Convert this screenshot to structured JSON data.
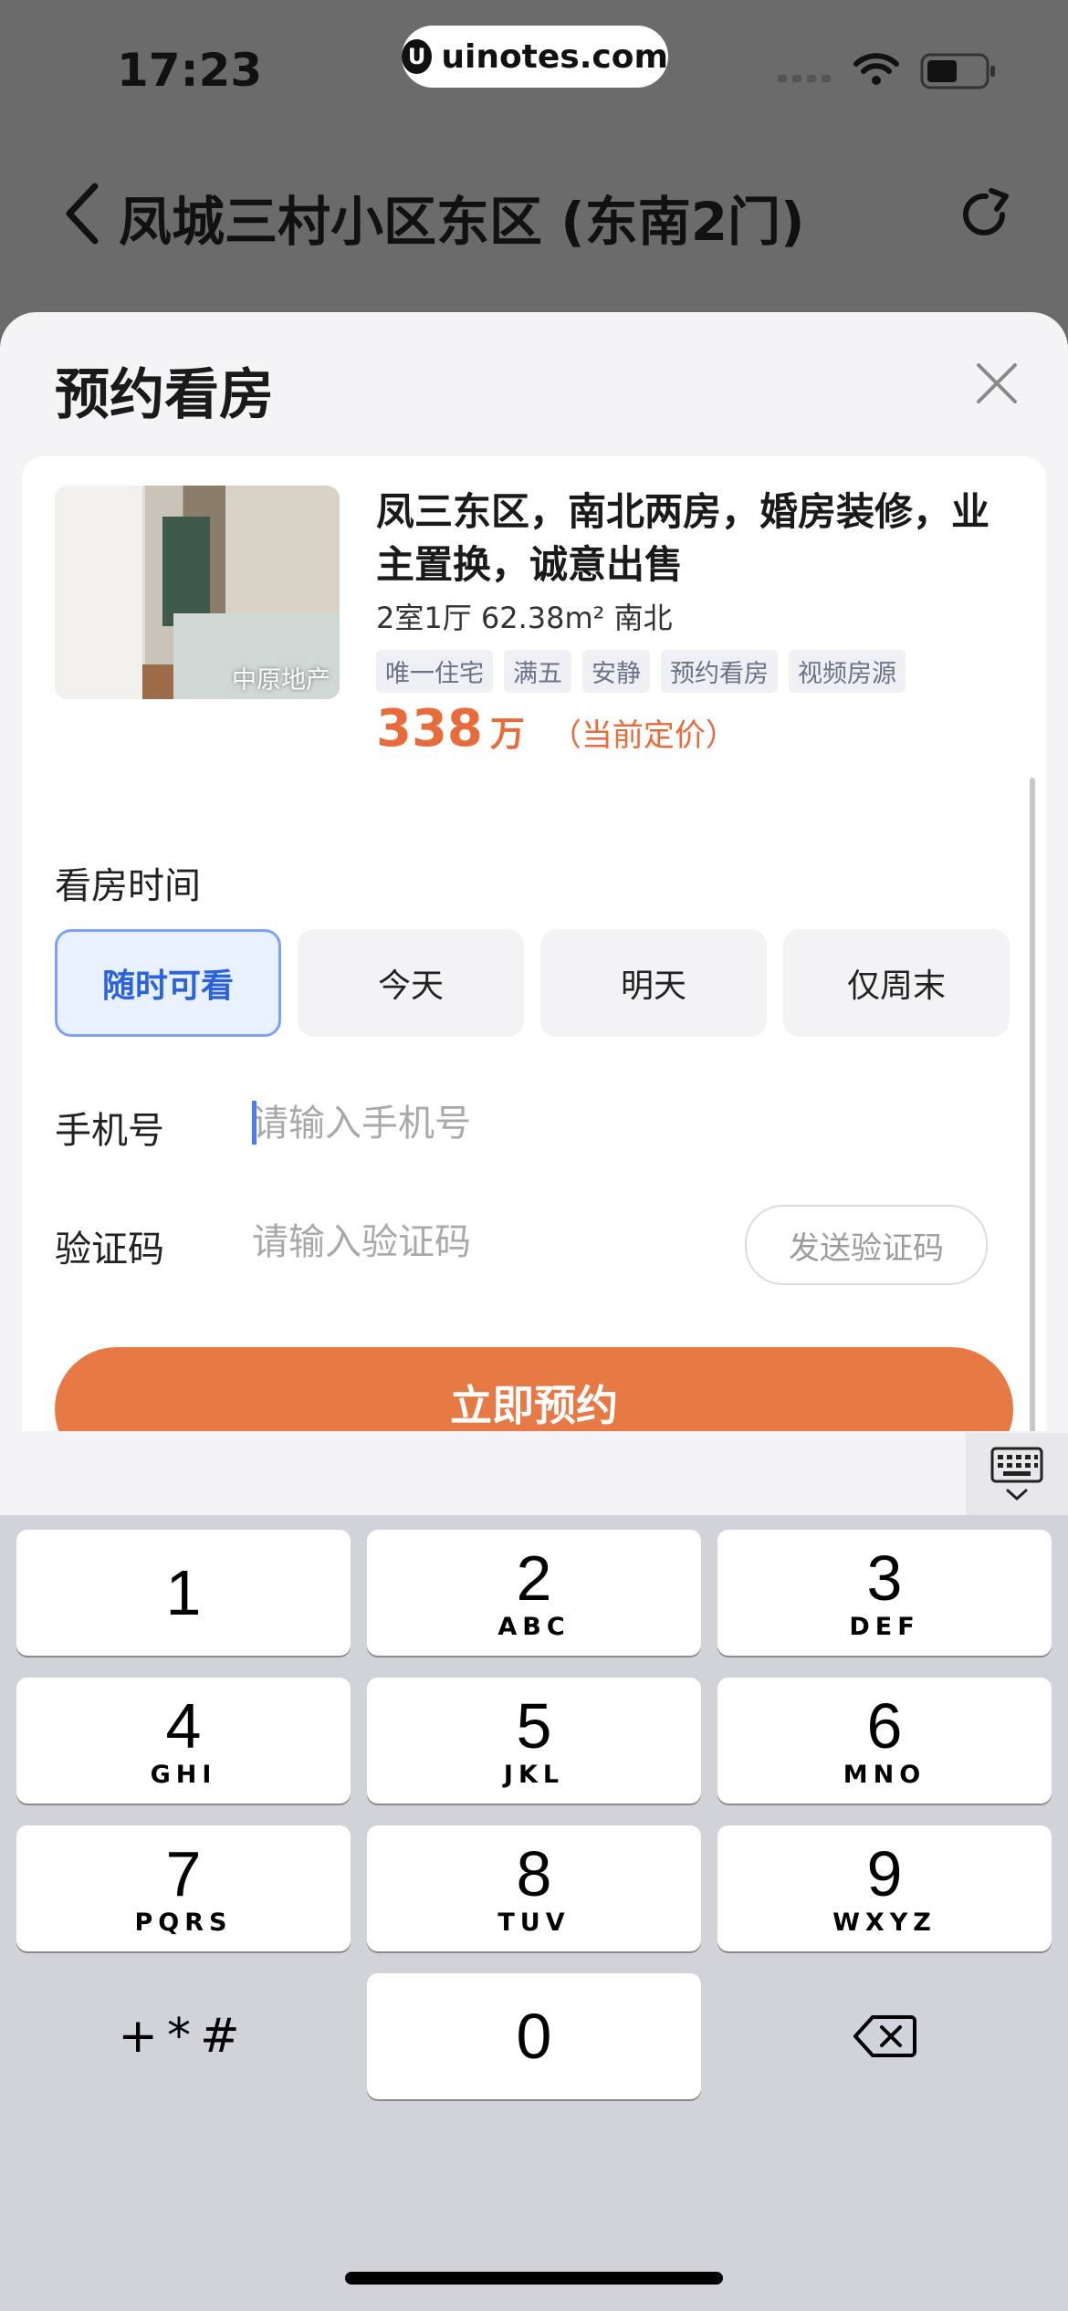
{
  "status_bar": {
    "time": "17:23",
    "source": "uinotes.com",
    "source_logo": "U"
  },
  "background_page": {
    "title": "凤城三村小区东区 (东南2门)"
  },
  "sheet": {
    "title": "预约看房",
    "listing": {
      "photo_label": "中原地产",
      "title": "凤三东区，南北两房，婚房装修，业主置换，诚意出售",
      "meta": "2室1厅  62.38m²  南北",
      "tags": [
        "唯一住宅",
        "满五",
        "安静",
        "预约看房",
        "视频房源"
      ],
      "price": "338",
      "price_unit": "万",
      "price_note": "（当前定价）"
    },
    "time_label": "看房时间",
    "time_options": [
      "随时可看",
      "今天",
      "明天",
      "仅周末"
    ],
    "selected_time": "随时可看",
    "phone_label": "手机号",
    "phone_placeholder": "请输入手机号",
    "code_label": "验证码",
    "code_placeholder": "请输入验证码",
    "send_code": "发送验证码",
    "submit": "立即预约"
  },
  "keyboard": {
    "keys": [
      {
        "num": "1",
        "letters": ""
      },
      {
        "num": "2",
        "letters": "ABC"
      },
      {
        "num": "3",
        "letters": "DEF"
      },
      {
        "num": "4",
        "letters": "GHI"
      },
      {
        "num": "5",
        "letters": "JKL"
      },
      {
        "num": "6",
        "letters": "MNO"
      },
      {
        "num": "7",
        "letters": "PQRS"
      },
      {
        "num": "8",
        "letters": "TUV"
      },
      {
        "num": "9",
        "letters": "WXYZ"
      }
    ],
    "symbols": "+*#",
    "zero": "0",
    "icons": [
      "keyboard-dismiss-icon",
      "backspace-icon"
    ]
  },
  "colors": {
    "accent_orange": "#e77944",
    "price_orange": "#e86b3c",
    "selected_blue": "#2b63d9"
  }
}
